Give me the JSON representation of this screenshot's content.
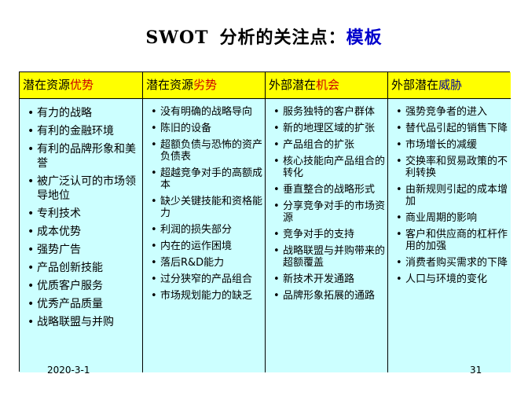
{
  "title": {
    "prefix": "SWOT",
    "main": "分析的关注点：",
    "accent": "模板"
  },
  "columns": [
    {
      "header_prefix": "潜在资源",
      "header_accent": "优势",
      "items": [
        "有力的战略",
        "有利的金融环境",
        "有利的品牌形象和美誉",
        "被广泛认可的市场领导地位",
        "专利技术",
        "成本优势",
        "强势广告",
        "产品创新技能",
        "优质客户服务",
        "优秀产品质量",
        "战略联盟与并购"
      ]
    },
    {
      "header_prefix": "潜在资源",
      "header_accent": "劣势",
      "items": [
        "没有明确的战略导向",
        "陈旧的设备",
        "超额负债与恐怖的资产负债表",
        "超越竞争对手的高额成本",
        "缺少关键技能和资格能力",
        "利润的损失部分",
        "内在的运作困境",
        "落后R&D能力",
        "过分狭窄的产品组合",
        "市场规划能力的缺乏"
      ]
    },
    {
      "header_prefix": "外部潜在",
      "header_accent": "机会",
      "items": [
        "服务独特的客户群体",
        "新的地理区域的扩张",
        "产品组合的扩张",
        "核心技能向产品组合的转化",
        "垂直整合的战略形式",
        "分享竞争对手的市场资源",
        "竞争对手的支持",
        "战略联盟与并购带来的超额覆盖",
        "新技术开发通路",
        "品牌形象拓展的通路"
      ]
    },
    {
      "header_prefix": "外部潜在",
      "header_accent": "威胁",
      "items": [
        "强势竞争者的进入",
        "替代品引起的销售下降",
        "市场增长的减缓",
        "交换率和贸易政策的不利转换",
        "由新规则引起的成本增加",
        "商业周期的影响",
        "客户和供应商的杠杆作用的加强",
        "消费者购买需求的下降",
        "人口与环境的变化"
      ]
    }
  ],
  "footer": {
    "date": "2020-3-1",
    "page": "31"
  },
  "colors": {
    "header_bg": "#ffff00",
    "body_bg": "#ccffff",
    "accent_red": "#cc0000",
    "accent_blue": "#0000cc"
  }
}
